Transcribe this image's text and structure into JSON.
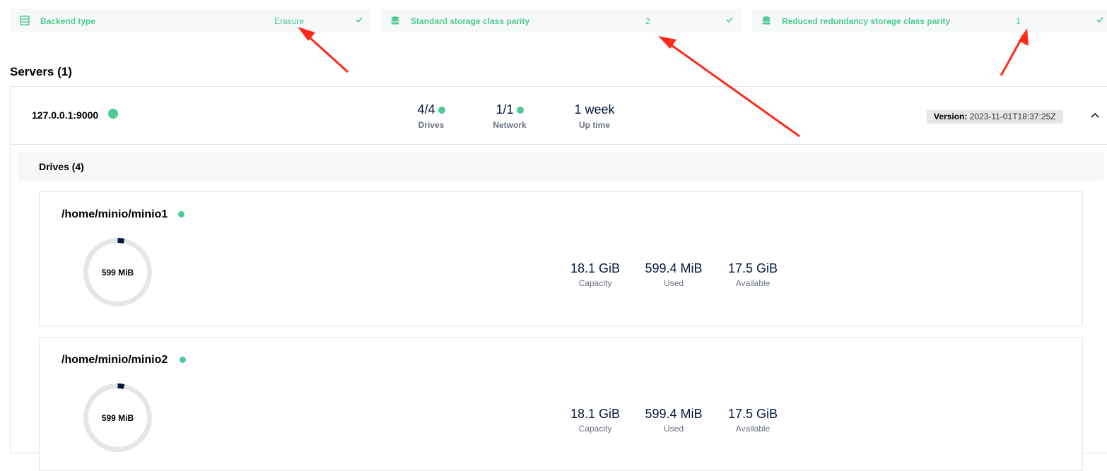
{
  "info_cards": [
    {
      "label": "Backend type",
      "value": "Erasure",
      "icon": "server-list-icon",
      "status_icon": "check-icon"
    },
    {
      "label": "Standard storage class parity",
      "value": "2",
      "icon": "storage-stack-icon",
      "status_icon": "check-icon"
    },
    {
      "label": "Reduced redundancy storage class parity",
      "value": "1",
      "icon": "storage-stack-icon",
      "status_icon": "check-icon"
    }
  ],
  "servers": {
    "title": "Servers (1)",
    "host": "127.0.0.1:9000",
    "drives_stat": {
      "value": "4/4",
      "label": "Drives"
    },
    "network_stat": {
      "value": "1/1",
      "label": "Network"
    },
    "uptime_stat": {
      "value": "1 week",
      "label": "Up time"
    },
    "version_label": "Version:",
    "version_value": "2023-11-01T18:37:25Z",
    "collapse_icon": "chevron-up-icon"
  },
  "drives": {
    "title": "Drives (4)",
    "items": [
      {
        "path": "/home/minio/minio1",
        "usage_label": "599 MiB",
        "used_fraction": 0.032,
        "capacity": "18.1 GiB",
        "capacity_label": "Capacity",
        "used": "599.4 MiB",
        "used_label": "Used",
        "available": "17.5 GiB",
        "available_label": "Available"
      },
      {
        "path": "/home/minio/minio2",
        "usage_label": "599 MiB",
        "used_fraction": 0.032,
        "capacity": "18.1 GiB",
        "capacity_label": "Capacity",
        "used": "599.4 MiB",
        "used_label": "Used",
        "available": "17.5 GiB",
        "available_label": "Available"
      }
    ]
  },
  "colors": {
    "accent_green": "#4ccb92",
    "annotation_red": "#ff2a1a",
    "donut_track": "#e3e8e6",
    "donut_used": "#07193e"
  }
}
